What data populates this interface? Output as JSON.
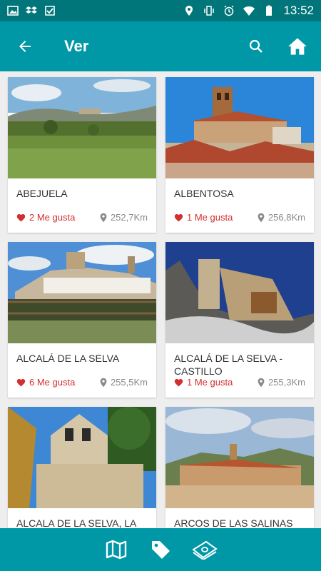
{
  "status_bar": {
    "time": "13:52"
  },
  "app_bar": {
    "title": "Ver"
  },
  "colors": {
    "primary": "#0097a7",
    "status": "#00767a",
    "like": "#d32f2f"
  },
  "icons": {
    "back": "arrow-back-icon",
    "search": "search-icon",
    "home": "home-icon",
    "map": "map-icon",
    "tag": "tag-icon",
    "money": "banknotes-icon"
  },
  "places": [
    {
      "name": "ABEJUELA",
      "likes": "2 Me gusta",
      "distance": "252,7Km",
      "image": "countryside-village-photo"
    },
    {
      "name": "ALBENTOSA",
      "likes": "1 Me gusta",
      "distance": "256,8Km",
      "image": "church-tower-photo"
    },
    {
      "name": "ALCALÁ DE LA SELVA",
      "likes": "6 Me gusta",
      "distance": "255,5Km",
      "image": "hilltop-village-photo"
    },
    {
      "name": "ALCALÁ DE LA SELVA - CASTILLO",
      "likes": "1 Me gusta",
      "distance": "255,3Km",
      "image": "castle-rock-photo"
    },
    {
      "name": "ALCALA DE LA SELVA, LA",
      "likes": "",
      "distance": "",
      "image": "chapel-bells-photo"
    },
    {
      "name": "ARCOS DE LAS SALINAS",
      "likes": "",
      "distance": "",
      "image": "mountain-town-photo"
    }
  ]
}
